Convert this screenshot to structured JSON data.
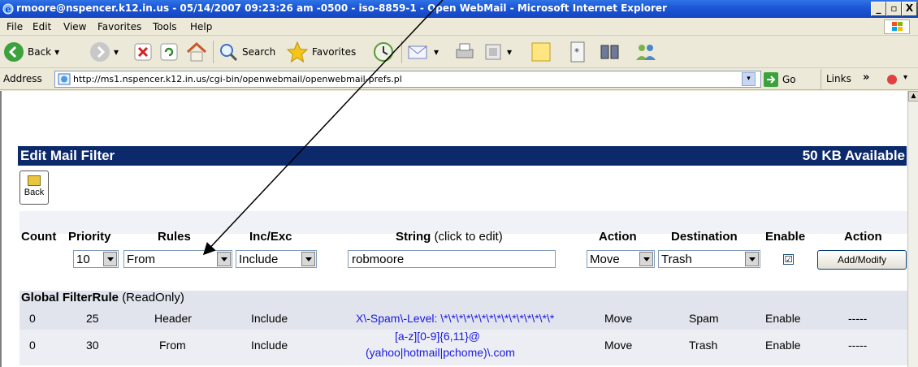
{
  "window": {
    "title": "rmoore@nspencer.k12.in.us - 05/14/2007 09:23:26 am -0500 - iso-8859-1 - Open WebMail - Microsoft Internet Explorer",
    "min": "_",
    "max": "▫",
    "close": "X"
  },
  "menu": [
    "File",
    "Edit",
    "View",
    "Favorites",
    "Tools",
    "Help"
  ],
  "toolbar": {
    "back": "Back",
    "search": "Search",
    "favorites": "Favorites",
    "dropdown_arrow": "▾"
  },
  "address": {
    "label": "Address",
    "url": "http://ms1.nspencer.k12.in.us/cgi-bin/openwebmail/openwebmail-prefs.pl",
    "go": "Go",
    "links": "Links",
    "links_chevron": "»"
  },
  "page": {
    "title": "Edit Mail Filter",
    "available": "50 KB Available",
    "back_label": "Back"
  },
  "filter": {
    "headers": {
      "count": "Count",
      "priority": "Priority",
      "rules": "Rules",
      "incexc": "Inc/Exc",
      "string": "String",
      "string_hint": "(click to edit)",
      "action": "Action",
      "destination": "Destination",
      "enable": "Enable",
      "action2": "Action"
    },
    "form": {
      "priority": "10",
      "rules": "From",
      "incexc": "Include",
      "string": "robmoore",
      "action": "Move",
      "destination": "Trash",
      "enable_mark": "☑",
      "submit": "Add/Modify"
    }
  },
  "global": {
    "title": "Global FilterRule",
    "subtitle": "(ReadOnly)",
    "rows": [
      {
        "count": "0",
        "priority": "25",
        "rule": "Header",
        "incexc": "Include",
        "string_line1": "X\\-Spam\\-Level: \\*\\*\\*\\*\\*\\*\\*\\*\\*\\*\\*\\*\\*\\*\\*",
        "string_line2": "",
        "action": "Move",
        "destination": "Spam",
        "enable": "Enable",
        "op": "-----"
      },
      {
        "count": "0",
        "priority": "30",
        "rule": "From",
        "incexc": "Include",
        "string_line1": "[a-z][0-9]{6,11}@",
        "string_line2": "(yahoo|hotmail|pchome)\\.com",
        "action": "Move",
        "destination": "Trash",
        "enable": "Enable",
        "op": "-----"
      }
    ]
  },
  "colors": {
    "title_bar": "#1a56d6",
    "header_bar": "#0c2a6b",
    "link_blue": "#1a1ae0",
    "global_band": "#e1e4ec"
  }
}
